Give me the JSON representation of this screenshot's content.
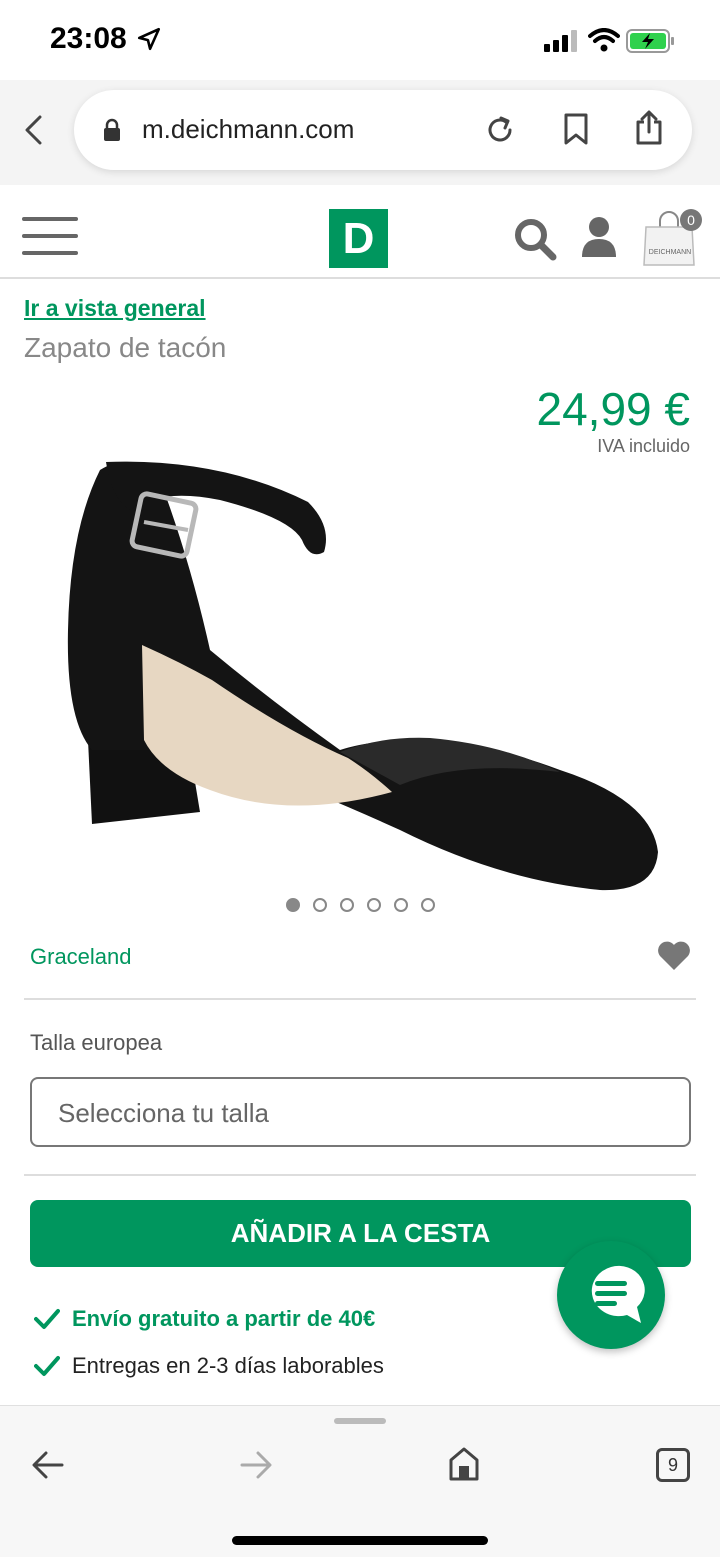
{
  "status_bar": {
    "time": "23:08"
  },
  "browser": {
    "url": "m.deichmann.com",
    "tab_count": "9"
  },
  "header": {
    "logo_letter": "D",
    "cart_count": "0",
    "cart_label": "DEICHMANN"
  },
  "product": {
    "back_link": "Ir a vista general",
    "title": "Zapato de tacón",
    "price": "24,99 €",
    "vat_note": "IVA incluido",
    "image_count": 6,
    "active_image": 1,
    "brand": "Graceland"
  },
  "size": {
    "label": "Talla europea",
    "placeholder": "Selecciona tu talla"
  },
  "actions": {
    "add_to_cart": "AÑADIR A LA CESTA"
  },
  "benefits": [
    "Envío gratuito a partir de 40€",
    "Entregas en 2-3 días laborables"
  ],
  "colors": {
    "brand_green": "#00965e"
  }
}
